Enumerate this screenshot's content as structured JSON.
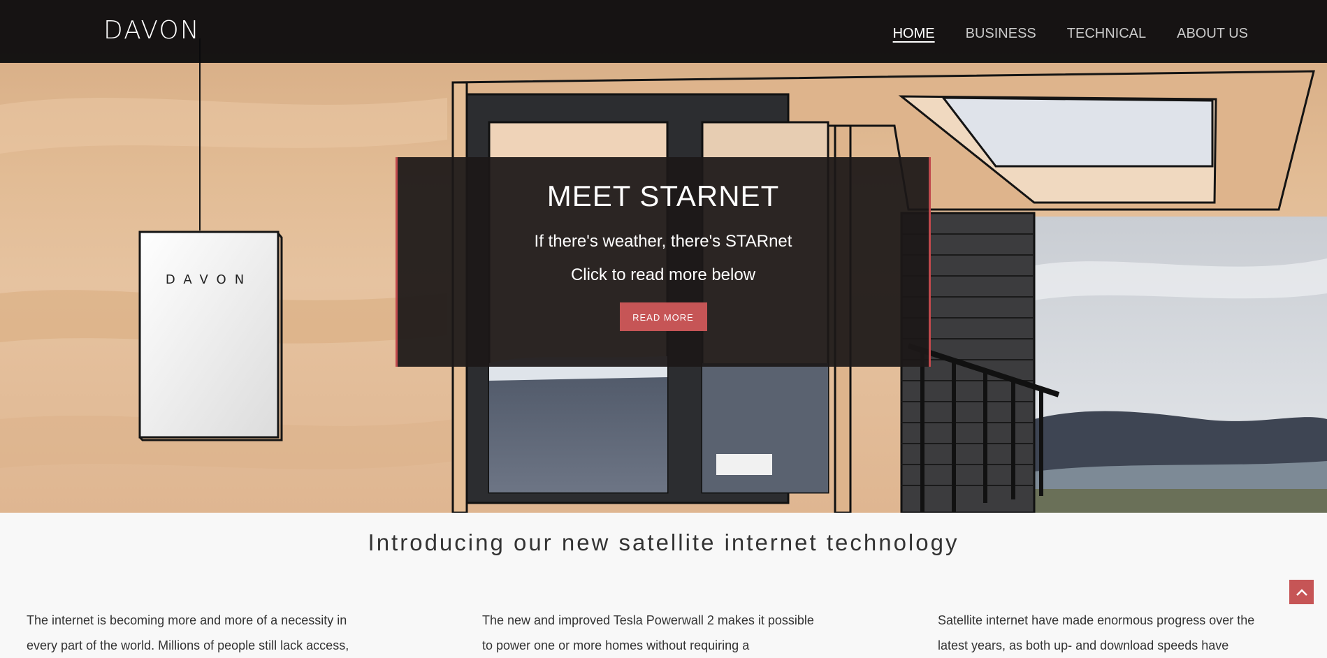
{
  "brand": {
    "logo": "DAVON"
  },
  "nav": {
    "items": [
      {
        "label": "HOME",
        "active": true
      },
      {
        "label": "BUSINESS",
        "active": false
      },
      {
        "label": "TECHNICAL",
        "active": false
      },
      {
        "label": "ABOUT US",
        "active": false
      }
    ]
  },
  "hero": {
    "title": "MEET STARNET",
    "subtitle": "If there's weather, there's STARnet",
    "subtitle2": "Click to read more below",
    "button_label": "READ MORE",
    "device_label": "DAVON"
  },
  "intro": {
    "heading": "Introducing our new satellite internet technology",
    "columns": [
      {
        "text": "The internet is becoming more and more of a necessity in every part of the world. Millions of people still lack access,"
      },
      {
        "text": "The new and improved Tesla Powerwall 2 makes it possible to power one or more homes without requiring a"
      },
      {
        "text": "Satellite internet have made enormous progress over the latest years, as both up- and download speeds have"
      }
    ]
  },
  "colors": {
    "accent": "#c65556",
    "nav_bg": "#0a0a0c",
    "card_bg": "#1c1818",
    "body_bg": "#f8f8f8"
  },
  "icons": {
    "back_to_top": "chevron-up-icon"
  }
}
